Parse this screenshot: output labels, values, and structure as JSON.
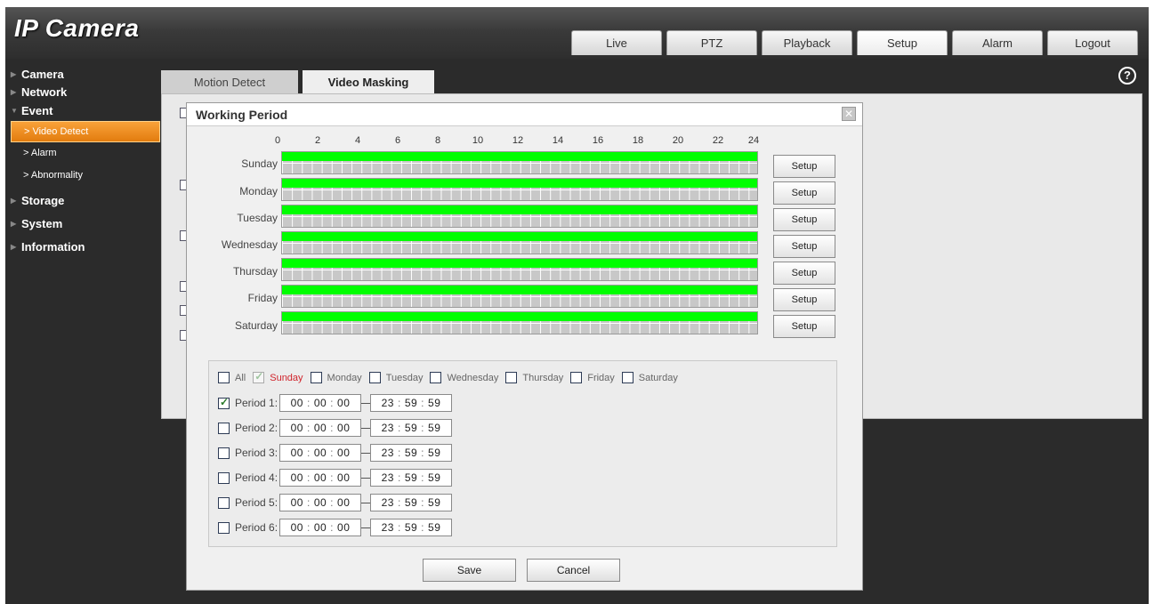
{
  "app": {
    "title": "IP Camera",
    "nav_tabs": [
      "Live",
      "PTZ",
      "Playback",
      "Setup",
      "Alarm",
      "Logout"
    ],
    "active_nav": "Setup"
  },
  "sidebar": {
    "items": [
      {
        "label": "Camera"
      },
      {
        "label": "Network"
      },
      {
        "label": "Event"
      },
      {
        "label": "Storage"
      },
      {
        "label": "System"
      },
      {
        "label": "Information"
      }
    ],
    "event_sub": [
      {
        "label": "> Video Detect"
      },
      {
        "label": "> Alarm"
      },
      {
        "label": "> Abnormality"
      }
    ]
  },
  "main": {
    "tabs": [
      "Motion Detect",
      "Video Masking"
    ],
    "active_tab": "Video Masking",
    "help_icon": "?"
  },
  "dialog": {
    "title": "Working Period",
    "close_icon": "close-icon",
    "hours": [
      "0",
      "2",
      "4",
      "6",
      "8",
      "10",
      "12",
      "14",
      "16",
      "18",
      "20",
      "22",
      "24"
    ],
    "days": [
      {
        "label": "Sunday",
        "setup": "Setup",
        "active_fraction": 1.0
      },
      {
        "label": "Monday",
        "setup": "Setup",
        "active_fraction": 1.0
      },
      {
        "label": "Tuesday",
        "setup": "Setup",
        "active_fraction": 1.0
      },
      {
        "label": "Wednesday",
        "setup": "Setup",
        "active_fraction": 1.0
      },
      {
        "label": "Thursday",
        "setup": "Setup",
        "active_fraction": 1.0
      },
      {
        "label": "Friday",
        "setup": "Setup",
        "active_fraction": 1.0
      },
      {
        "label": "Saturday",
        "setup": "Setup",
        "active_fraction": 1.0
      }
    ],
    "day_select": {
      "all": "All",
      "days": [
        "Sunday",
        "Monday",
        "Tuesday",
        "Wednesday",
        "Thursday",
        "Friday",
        "Saturday"
      ],
      "current_day": "Sunday"
    },
    "periods": [
      {
        "label": "Period 1:",
        "checked": true,
        "start": [
          "00",
          "00",
          "00"
        ],
        "end": [
          "23",
          "59",
          "59"
        ]
      },
      {
        "label": "Period 2:",
        "checked": false,
        "start": [
          "00",
          "00",
          "00"
        ],
        "end": [
          "23",
          "59",
          "59"
        ]
      },
      {
        "label": "Period 3:",
        "checked": false,
        "start": [
          "00",
          "00",
          "00"
        ],
        "end": [
          "23",
          "59",
          "59"
        ]
      },
      {
        "label": "Period 4:",
        "checked": false,
        "start": [
          "00",
          "00",
          "00"
        ],
        "end": [
          "23",
          "59",
          "59"
        ]
      },
      {
        "label": "Period 5:",
        "checked": false,
        "start": [
          "00",
          "00",
          "00"
        ],
        "end": [
          "23",
          "59",
          "59"
        ]
      },
      {
        "label": "Period 6:",
        "checked": false,
        "start": [
          "00",
          "00",
          "00"
        ],
        "end": [
          "23",
          "59",
          "59"
        ]
      }
    ],
    "save_label": "Save",
    "cancel_label": "Cancel"
  },
  "colors": {
    "accent_orange": "#f29318",
    "active_period_green": "#00ff00",
    "current_day_red": "#d0242c"
  }
}
